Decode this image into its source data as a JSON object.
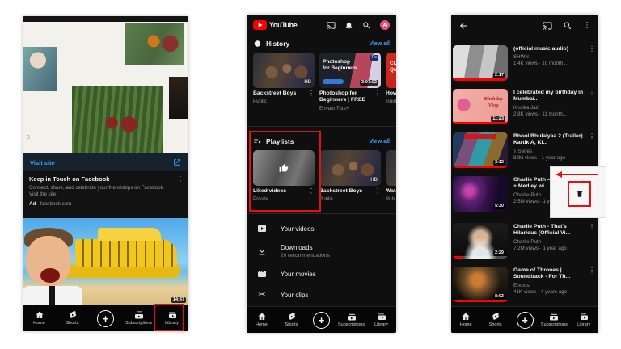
{
  "colors": {
    "annotation_red": "#e01212",
    "link_blue": "#3ea6ff",
    "youtube_red": "#ff0000",
    "progress_red": "#ff0000",
    "dark_bg": "#0f0f0f"
  },
  "icons": {
    "kebab": "⋮",
    "scissors": "✂",
    "plus": "+"
  },
  "nav": {
    "home": "Home",
    "shorts": "Shorts",
    "subscriptions": "Subscriptions",
    "library": "Library"
  },
  "phone1": {
    "page_marker": "3",
    "visit_site_label": "Visit site",
    "ad_card": {
      "title": "Keep in Touch on Facebook",
      "body": "Connect, share, and celebrate your friendships on Facebook. Visit the site.",
      "ad_badge": "Ad",
      "separator": "·",
      "domain": "facebook.com"
    },
    "video": {
      "duration": "14:47"
    }
  },
  "phone2": {
    "app_name": "YouTube",
    "avatar_letter": "A",
    "history": {
      "title": "History",
      "view_all": "View all",
      "items": [
        {
          "title": "Backstreet Boys",
          "subtitle": "Public",
          "thumb_badge": "HD"
        },
        {
          "title": "Photoshop for Beginners | FREE C..",
          "subtitle": "Envato Tuts+",
          "duration": "3:07:02",
          "thumb_line1": "Photoshop",
          "thumb_line2": "for Beginners",
          "thumb_badge": "Ps"
        },
        {
          "title": "How... Que...",
          "subtitle": "Guid...",
          "thumb_line1": "Cl..",
          "thumb_line2": "Qu.."
        }
      ]
    },
    "playlists": {
      "title": "Playlists",
      "view_all": "View all",
      "items": [
        {
          "title": "Liked videos",
          "subtitle": "Private"
        },
        {
          "title": "Backstreet Boys",
          "subtitle": "Public",
          "thumb_badge": "HD"
        },
        {
          "title": "Wat...",
          "subtitle": "Pub..."
        }
      ]
    },
    "menu": [
      {
        "label": "Your videos"
      },
      {
        "label": "Downloads",
        "sublabel": "20 recommendations"
      },
      {
        "label": "Your movies"
      },
      {
        "label": "Your clips"
      }
    ]
  },
  "phone3": {
    "videos": [
      {
        "title": "(official music audio)",
        "channel": "SHWN",
        "meta": "1.4K views · 10 month...",
        "duration": "2:17",
        "progress": 100
      },
      {
        "title": "I celebrated my birthday in Mumbai..",
        "channel": "Krutika Jain",
        "meta": "2.8K views · 11 month...",
        "duration": "11:23",
        "progress": 100,
        "thumb_line1": "Birthday",
        "thumb_line2": "Vlog"
      },
      {
        "title": "Bhool Bhulaiyaa 2 (Trailer) Kartik A, Ki...",
        "channel": "T-Series",
        "meta": "82M views · 1 year ago",
        "duration": "3:12",
        "progress": 100
      },
      {
        "title": "Charlie Puth – Light Switch + Medley wi...",
        "channel": "Charlie Puth",
        "meta": "2.5M views · 1 year ago",
        "duration": "5:30",
        "progress": 0
      },
      {
        "title": "Charlie Puth - That's Hilarious [Official Vi...",
        "channel": "Charlie Puth",
        "meta": "7.2M views · 1 year ago",
        "duration": "2:29",
        "progress": 16
      },
      {
        "title": "Game of Thrones | Soundtrack - For Th...",
        "channel": "Erebus",
        "meta": "41K views · 4 years ago",
        "duration": "8:03",
        "progress": 100
      }
    ]
  }
}
